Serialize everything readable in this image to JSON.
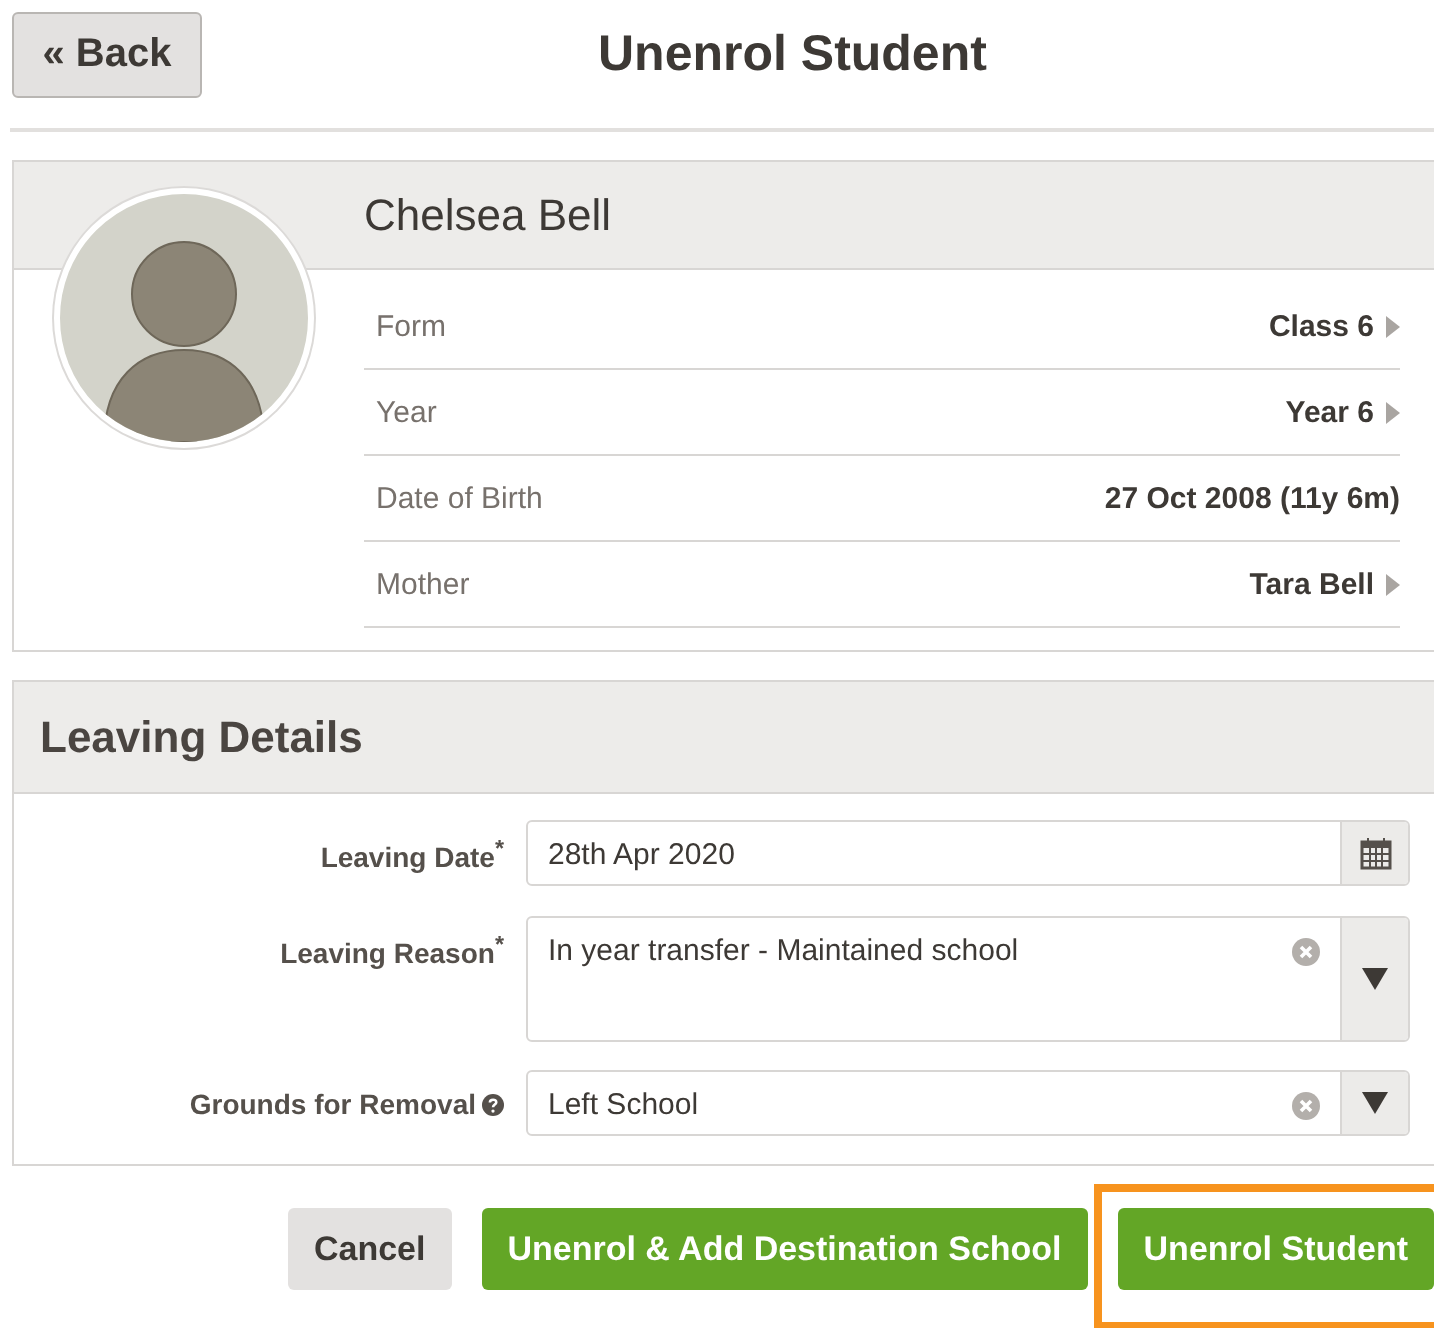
{
  "page": {
    "back_button": "« Back",
    "title": "Unenrol Student"
  },
  "student": {
    "name": "Chelsea Bell",
    "details": [
      {
        "label": "Form",
        "value": "Class 6",
        "link": true
      },
      {
        "label": "Year",
        "value": "Year 6",
        "link": true
      },
      {
        "label": "Date of Birth",
        "value": "27 Oct 2008 (11y 6m)",
        "link": false
      },
      {
        "label": "Mother",
        "value": "Tara Bell",
        "link": true
      }
    ]
  },
  "leaving_details": {
    "title": "Leaving Details",
    "fields": [
      {
        "kind": "date",
        "label": "Leaving Date$^{*}$",
        "value": "28th Apr 2020",
        "help": false,
        "tall": false
      },
      {
        "kind": "select",
        "label": "Leaving Reason$^{*}$",
        "value": "In year transfer - Maintained school",
        "help": false,
        "tall": true
      },
      {
        "kind": "select",
        "label": "Grounds for Removal",
        "value": "Left School",
        "help": true,
        "tall": false
      }
    ]
  },
  "buttons": [
    {
      "label": "Cancel",
      "kind": "secondary",
      "highlighted": false
    },
    {
      "label": "Unenrol & Add Destination School",
      "kind": "primary",
      "highlighted": false
    },
    {
      "label": "Unenrol Student",
      "kind": "primary",
      "highlighted": true
    }
  ]
}
